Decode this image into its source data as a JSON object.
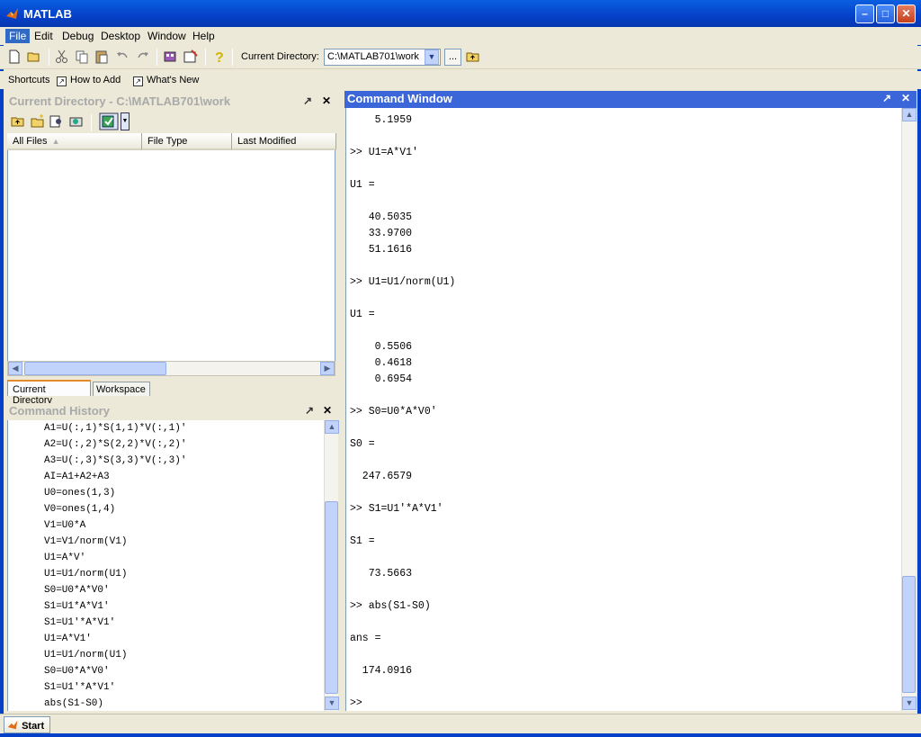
{
  "window": {
    "title": "MATLAB"
  },
  "menu": [
    "File",
    "Edit",
    "Debug",
    "Desktop",
    "Window",
    "Help"
  ],
  "toolbar": {
    "current_directory_label": "Current Directory:",
    "current_directory_value": "C:\\MATLAB701\\work",
    "browse_label": "..."
  },
  "shortcuts": {
    "label": "Shortcuts",
    "items": [
      "How to Add",
      "What's New"
    ]
  },
  "current_directory_panel": {
    "title": "Current Directory - C:\\MATLAB701\\work",
    "columns": [
      "All Files",
      "File Type",
      "Last Modified"
    ],
    "tabs": [
      "Current Directory",
      "Workspace"
    ]
  },
  "command_history": {
    "title": "Command History",
    "lines": [
      "A1=U(:,1)*S(1,1)*V(:,1)'",
      "A2=U(:,2)*S(2,2)*V(:,2)'",
      "A3=U(:,3)*S(3,3)*V(:,3)'",
      "AI=A1+A2+A3",
      "U0=ones(1,3)",
      "V0=ones(1,4)",
      "V1=U0*A",
      "V1=V1/norm(V1)",
      "U1=A*V'",
      "U1=U1/norm(U1)",
      "S0=U0*A*V0'",
      "S1=U1*A*V1'",
      "S1=U1'*A*V1'",
      "U1=A*V1'",
      "U1=U1/norm(U1)",
      "S0=U0*A*V0'",
      "S1=U1'*A*V1'",
      "abs(S1-S0)"
    ]
  },
  "command_window": {
    "title": "Command Window",
    "lines": [
      "    5.1959",
      "",
      ">> U1=A*V1'",
      "",
      "U1 =",
      "",
      "   40.5035",
      "   33.9700",
      "   51.1616",
      "",
      ">> U1=U1/norm(U1)",
      "",
      "U1 =",
      "",
      "    0.5506",
      "    0.4618",
      "    0.6954",
      "",
      ">> S0=U0*A*V0'",
      "",
      "S0 =",
      "",
      "  247.6579",
      "",
      ">> S1=U1'*A*V1'",
      "",
      "S1 =",
      "",
      "   73.5663",
      "",
      ">> abs(S1-S0)",
      "",
      "ans =",
      "",
      "  174.0916",
      "",
      ">>"
    ]
  },
  "statusbar": {
    "start_label": "Start"
  },
  "colors": {
    "title_blue": "#0540c8",
    "active_panel": "#3a66d9",
    "matlab_orange": "#e06b1a"
  },
  "icons": [
    "matlab-logo-icon",
    "new-file-icon",
    "open-file-icon",
    "cut-icon",
    "copy-icon",
    "paste-icon",
    "undo-icon",
    "redo-icon",
    "simulink-icon",
    "guide-icon",
    "help-icon",
    "up-folder-icon"
  ]
}
